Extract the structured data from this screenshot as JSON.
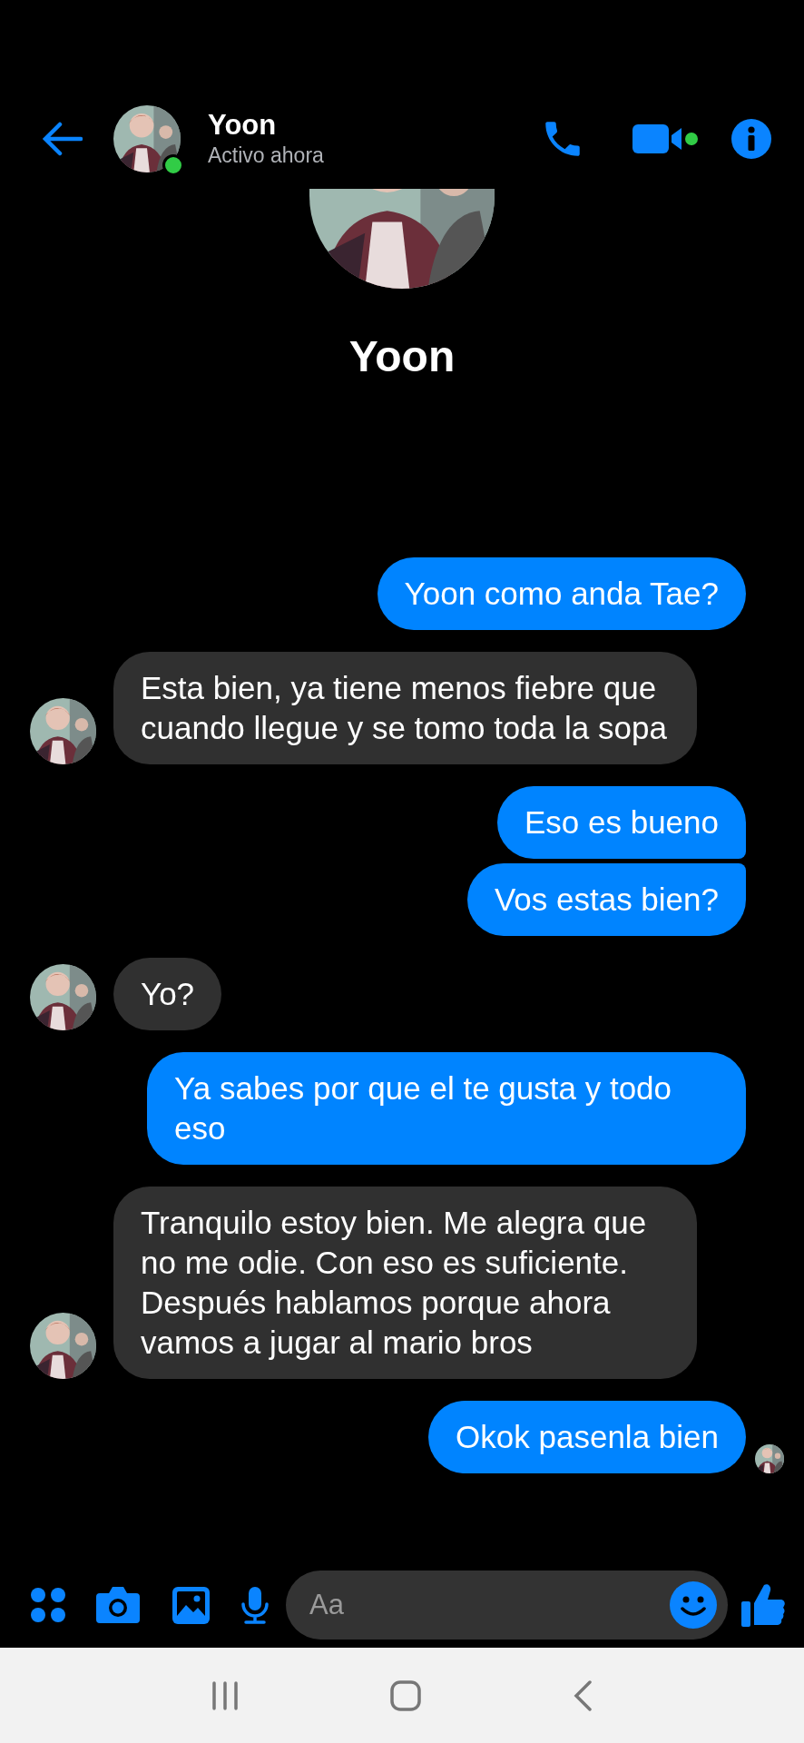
{
  "header": {
    "name": "Yoon",
    "status": "Activo ahora",
    "online": true
  },
  "profile": {
    "name": "Yoon"
  },
  "messages": [
    {
      "kind": "sent",
      "text": "Yoon como anda Tae?",
      "seen": false
    },
    {
      "kind": "received",
      "text": "Esta bien, ya tiene menos fiebre que cuando llegue y se tomo toda la sopa"
    },
    {
      "kind": "sent",
      "text": "Eso es bueno",
      "seen": false
    },
    {
      "kind": "sent",
      "text": "Vos estas bien?",
      "seen": false
    },
    {
      "kind": "received",
      "text": "Yo?"
    },
    {
      "kind": "sent",
      "text": "Ya sabes por que el te gusta y todo eso",
      "seen": false
    },
    {
      "kind": "received",
      "text": "Tranquilo estoy bien. Me alegra que no me odie. Con eso es suficiente. Después hablamos porque ahora vamos a jugar al mario bros"
    },
    {
      "kind": "sent",
      "text": "Okok pasenla bien",
      "seen": true
    }
  ],
  "composer": {
    "placeholder": "Aa"
  }
}
